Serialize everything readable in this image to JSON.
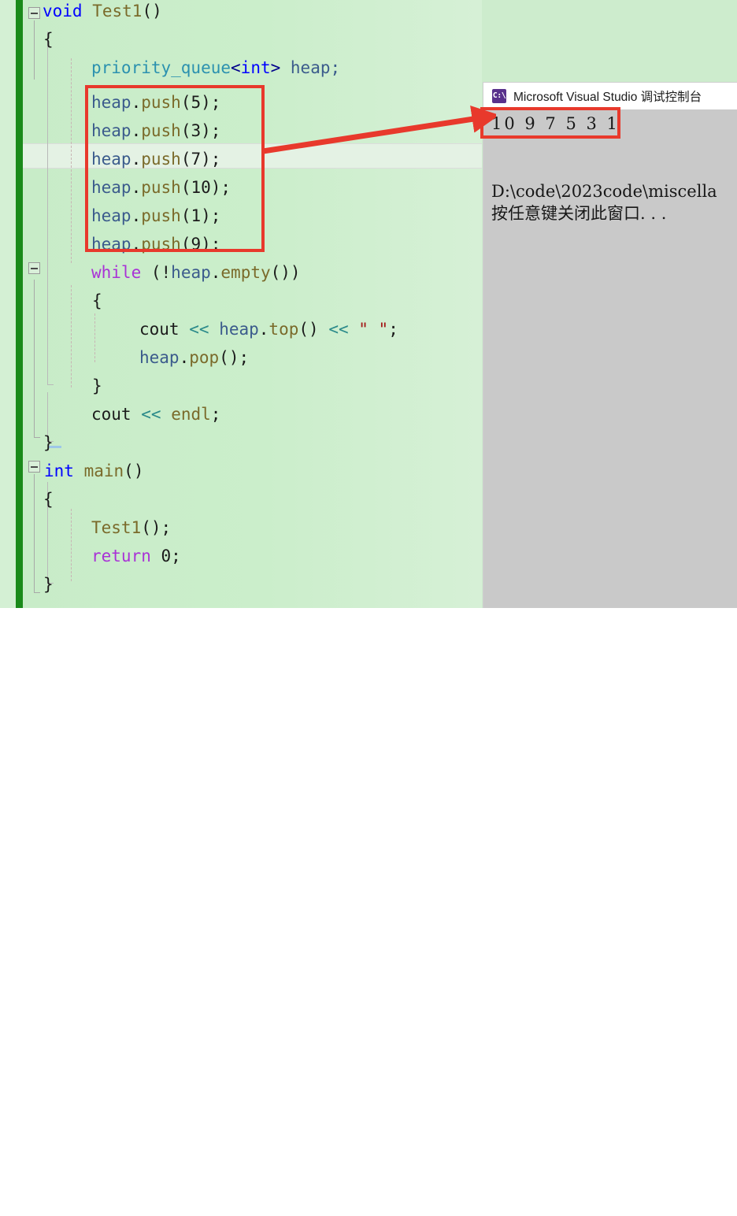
{
  "editor": {
    "name": "visual-studio-code-editor",
    "background_color": "#cdeccd",
    "change_bar_color": "#1a8a1a",
    "lines": [
      {
        "indent": 0,
        "text": "void Test1()"
      },
      {
        "indent": 1,
        "text": "{"
      },
      {
        "indent": 2,
        "text": "priority_queue<int> heap;"
      },
      {
        "indent": 2,
        "text": "heap.push(5);"
      },
      {
        "indent": 2,
        "text": "heap.push(3);"
      },
      {
        "indent": 2,
        "text": "heap.push(7);"
      },
      {
        "indent": 2,
        "text": "heap.push(10);"
      },
      {
        "indent": 2,
        "text": "heap.push(1);"
      },
      {
        "indent": 2,
        "text": "heap.push(9);"
      },
      {
        "indent": 2,
        "text": "while (!heap.empty())"
      },
      {
        "indent": 2,
        "text": "{"
      },
      {
        "indent": 3,
        "text": "cout << heap.top() << \" \";"
      },
      {
        "indent": 3,
        "text": "heap.pop();"
      },
      {
        "indent": 2,
        "text": "}"
      },
      {
        "indent": 2,
        "text": "cout << endl;"
      },
      {
        "indent": 1,
        "text": "}"
      },
      {
        "indent": 0,
        "text": "int main()"
      },
      {
        "indent": 1,
        "text": "{"
      },
      {
        "indent": 2,
        "text": "Test1();"
      },
      {
        "indent": 2,
        "text": "return 0;"
      },
      {
        "indent": 1,
        "text": "}"
      }
    ],
    "tokens": {
      "void": "void",
      "test1": "Test1",
      "paren_empty": "()",
      "brace_open": "{",
      "brace_close": "}",
      "priority_queue": "priority_queue",
      "angle_open": "<",
      "int": "int",
      "angle_close": ">",
      "heap_decl": " heap;",
      "heap": "heap",
      "dot": ".",
      "push": "push",
      "pop": "pop",
      "top": "top",
      "empty": "empty",
      "while": "while",
      "return": "return",
      "cout": "cout",
      "endl": "endl",
      "shift": "<<",
      "string_space": "\" \"",
      "semi": ";",
      "zero": "0",
      "bang": "!",
      "main": "main",
      "arg5": "(5);",
      "arg3": "(3);",
      "arg7": "(7);",
      "arg10": "(10);",
      "arg1": "(1);",
      "arg9": "(9);",
      "call_empty": "();",
      "while_cond_open": " (",
      "while_cond_close": "())"
    },
    "colors": {
      "keyword": "#0000ff",
      "control": "#a933d6",
      "type": "#2b91af",
      "function": "#7a6a2a",
      "variable": "#3b5b8c",
      "operator": "#2b8a8a",
      "string": "#a31515",
      "plain": "#1b1b1b"
    }
  },
  "annotations": {
    "code_box_label": "red-highlight-box-push-statements",
    "console_box_label": "red-highlight-box-console-output",
    "arrow_label": "red-arrow-code-to-output",
    "color": "#e8392c"
  },
  "console": {
    "title": "Microsoft Visual Studio 调试控制台",
    "icon_text": "C:\\",
    "icon_color": "#59318c",
    "output": "10 9 7 5 3 1",
    "path_line": "D:\\code\\2023code\\miscella",
    "prompt_line": "按任意键关闭此窗口. . .",
    "background_color": "#c9c9c9",
    "titlebar_color": "#ffffff"
  }
}
